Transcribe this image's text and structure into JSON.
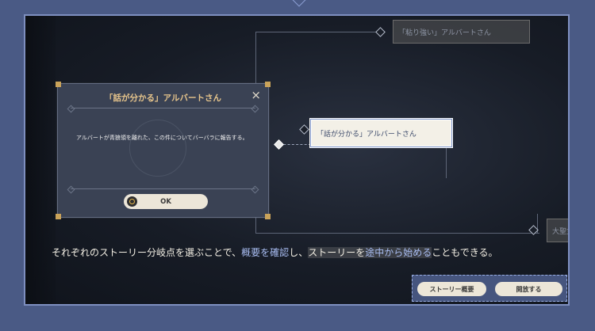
{
  "tree": {
    "node_top": "「粘り強い」アルバートさん",
    "node_selected": "「話が分かる」アルバートさん",
    "node_right_partial": "大聖女"
  },
  "dialog": {
    "title": "「話が分かる」アルバートさん",
    "close_icon": "×",
    "body": "アルバートが青狼領を離れた、この件についてバーバラに報告する。",
    "ok_label": "OK"
  },
  "tutorial": {
    "part1": "それぞれのストーリー分岐点を選ぶことで、",
    "hl1": "概要を確認",
    "part2": "し、",
    "part3": "ストーリーを",
    "hl2": "途中から始める",
    "part4": "こともできる。"
  },
  "buttons": {
    "summary_label": "ストーリー概要",
    "open_label": "開放する"
  },
  "colors": {
    "frame_border": "#7e8fc0",
    "highlight_text": "#a9bdf2",
    "dialog_title": "#e7c58c"
  }
}
